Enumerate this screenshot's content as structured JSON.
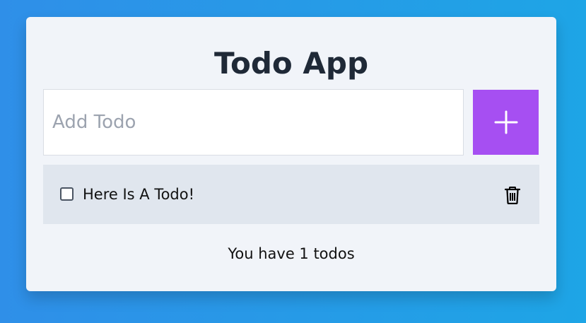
{
  "app": {
    "title": "Todo App"
  },
  "input": {
    "placeholder": "Add Todo",
    "value": ""
  },
  "add_button": {
    "icon": "plus-icon",
    "color": "#a64ff2"
  },
  "todos": [
    {
      "text": "Here Is A Todo!",
      "completed": false,
      "delete_icon": "trash-icon"
    }
  ],
  "footer": {
    "count_text": "You have 1 todos"
  },
  "colors": {
    "background_start": "#2f8fe8",
    "background_end": "#1ea5e6",
    "card": "#f1f4f9",
    "todo_item": "#e0e6ee",
    "title_text": "#1f2937"
  }
}
